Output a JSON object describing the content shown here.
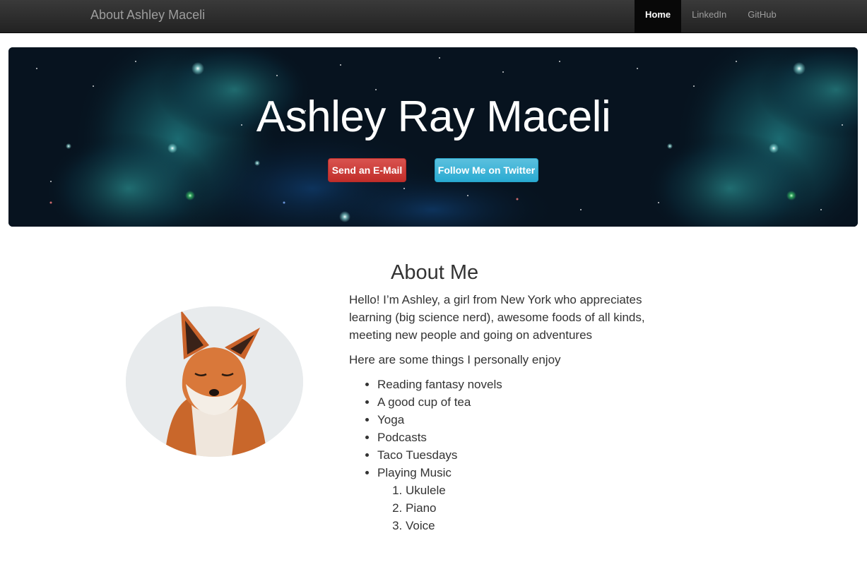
{
  "navbar": {
    "brand": "About Ashley Maceli",
    "items": [
      {
        "label": "Home",
        "active": true
      },
      {
        "label": "LinkedIn",
        "active": false
      },
      {
        "label": "GitHub",
        "active": false
      }
    ]
  },
  "hero": {
    "title": "Ashley Ray Maceli",
    "email_button": "Send an E-Mail",
    "twitter_button": "Follow Me on Twitter"
  },
  "about": {
    "heading": "About Me",
    "intro": "Hello! I’m Ashley, a girl from New York who appreciates learning (big science nerd), awesome foods of all kinds, meeting new people and going on adventures",
    "enjoy_intro": "Here are some things I personally enjoy",
    "enjoy_items": [
      "Reading fantasy novels",
      "A good cup of tea",
      "Yoga",
      "Podcasts",
      "Taco Tuesdays",
      "Playing Music"
    ],
    "music_items": [
      "Ukulele",
      "Piano",
      "Voice"
    ]
  },
  "colors": {
    "navbar": "#222222",
    "email_button": "#d9534f",
    "twitter_button": "#5bc0de",
    "text": "#333333"
  }
}
